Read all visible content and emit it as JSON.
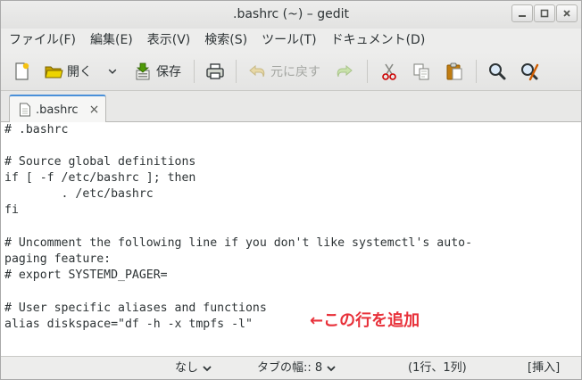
{
  "window": {
    "title": ".bashrc (~) – gedit"
  },
  "menu": [
    "ファイル(F)",
    "編集(E)",
    "表示(V)",
    "検索(S)",
    "ツール(T)",
    "ドキュメント(D)"
  ],
  "toolbar": {
    "open_label": "開く",
    "save_label": "保存",
    "undo_label": "元に戻す"
  },
  "tab": {
    "label": ".bashrc",
    "close": "×"
  },
  "editor": {
    "lines": [
      "# .bashrc",
      "",
      "# Source global definitions",
      "if [ -f /etc/bashrc ]; then",
      "        . /etc/bashrc",
      "fi",
      "",
      "# Uncomment the following line if you don't like systemctl's auto-",
      "paging feature:",
      "# export SYSTEMD_PAGER=",
      "",
      "# User specific aliases and functions",
      "alias diskspace=\"df -h -x tmpfs -l\""
    ],
    "annotation": "←この行を追加"
  },
  "statusbar": {
    "language": "なし",
    "tab_width_label": "タブの幅:: 8",
    "position": "(1行、1列)",
    "mode": "[挿入]"
  },
  "colors": {
    "annotation": "#e8313a",
    "tab_accent": "#4a90d9"
  }
}
